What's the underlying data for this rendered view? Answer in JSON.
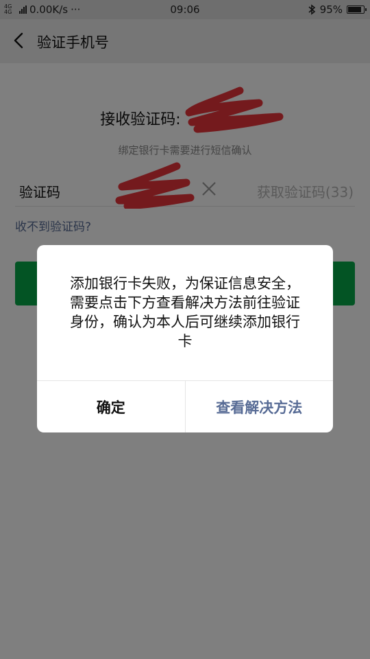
{
  "status_bar": {
    "network": "4G 4G",
    "speed": "0.00K/s",
    "more": "···",
    "time": "09:06",
    "bluetooth_icon": "bluetooth-icon",
    "battery_percent": "95%",
    "battery_level": 0.95
  },
  "nav": {
    "back_icon": "chevron-left-icon",
    "title": "验证手机号"
  },
  "verify": {
    "receive_label": "接收验证码:",
    "subtitle": "绑定银行卡需要进行短信确认",
    "code_label": "验证码",
    "clear_icon": "close-icon",
    "get_code": "获取验证码(33)",
    "no_code_link": "收不到验证码?"
  },
  "dialog": {
    "message": "添加银行卡失败，为保证信息安全，需要点击下方查看解决方法前往验证身份，确认为本人后可继续添加银行卡",
    "ok_label": "确定",
    "solution_label": "查看解决方法"
  },
  "colors": {
    "primary_green": "#07a848",
    "link_blue": "#576b95",
    "redaction_red": "#e8343a"
  }
}
